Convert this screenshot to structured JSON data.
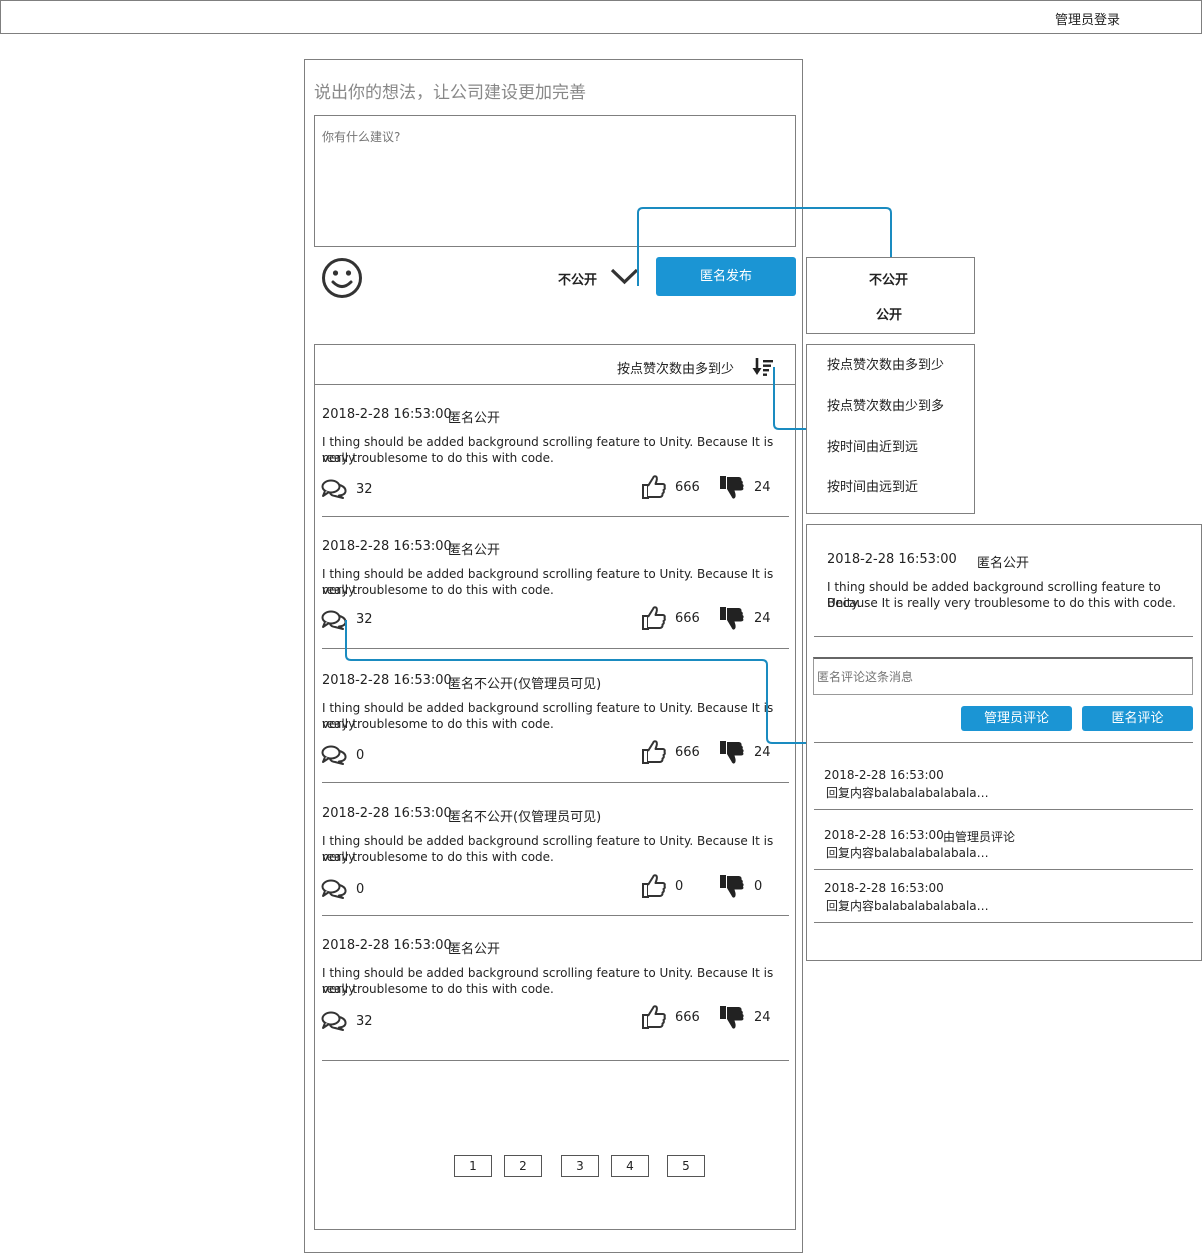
{
  "header": {
    "admin_login": "管理员登录"
  },
  "composer": {
    "title": "说出你的想法，让公司建设更加完善",
    "placeholder": "你有什么建议?",
    "visibility_value": "不公开",
    "publish_button": "匿名发布"
  },
  "visibility_menu": {
    "options": [
      "不公开",
      "公开"
    ]
  },
  "sort": {
    "current": "按点赞次数由多到少",
    "options": [
      "按点赞次数由多到少",
      "按点赞次数由少到多",
      "按时间由近到远",
      "按时间由远到近"
    ]
  },
  "posts": [
    {
      "time": "2018-2-28 16:53:00",
      "tag": "匿名公开",
      "line1": "I thing should be added background scrolling feature to Unity. Because It is really",
      "line2": "very troublesome to do this with code.",
      "comments": "32",
      "likes": "666",
      "dislikes": "24"
    },
    {
      "time": "2018-2-28 16:53:00",
      "tag": "匿名公开",
      "line1": "I thing should be added background scrolling feature to Unity. Because It is really",
      "line2": "very troublesome to do this with code.",
      "comments": "32",
      "likes": "666",
      "dislikes": "24"
    },
    {
      "time": "2018-2-28 16:53:00",
      "tag": "匿名不公开(仅管理员可见)",
      "line1": "I thing should be added background scrolling feature to Unity. Because It is really",
      "line2": "very troublesome to do this with code.",
      "comments": "0",
      "likes": "666",
      "dislikes": "24"
    },
    {
      "time": "2018-2-28 16:53:00",
      "tag": "匿名不公开(仅管理员可见)",
      "line1": "I thing should be added background scrolling feature to Unity. Because It is really",
      "line2": "very troublesome to do this with code.",
      "comments": "0",
      "likes": "0",
      "dislikes": "0"
    },
    {
      "time": "2018-2-28 16:53:00",
      "tag": "匿名公开",
      "line1": "I thing should be added background scrolling feature to Unity. Because It is really",
      "line2": "very troublesome to do this with code.",
      "comments": "32",
      "likes": "666",
      "dislikes": "24"
    }
  ],
  "pagination": [
    "1",
    "2",
    "3",
    "4",
    "5"
  ],
  "detail": {
    "time": "2018-2-28 16:53:00",
    "tag": "匿名公开",
    "line1": "I thing should be added background scrolling feature to Unity.",
    "line2": "Because It is really very troublesome to do this with code.",
    "comment_placeholder": "匿名评论这条消息",
    "admin_comment_button": "管理员评论",
    "anon_comment_button": "匿名评论",
    "replies": [
      {
        "time": "2018-2-28 16:53:00",
        "by": "",
        "content": "回复内容balabalabalabala…"
      },
      {
        "time": "2018-2-28 16:53:00",
        "by": "由管理员评论",
        "content": "回复内容balabalabalabala…"
      },
      {
        "time": "2018-2-28 16:53:00",
        "by": "",
        "content": "回复内容balabalabalabala…"
      }
    ]
  },
  "colors": {
    "accent": "#1b95d4",
    "wire": "#1a8bc0",
    "border": "#7f7f7f"
  },
  "icons": [
    "smiley-icon",
    "chevron-down-icon",
    "sort-descending-icon",
    "comment-icon",
    "thumbs-up-icon",
    "thumbs-down-icon"
  ]
}
